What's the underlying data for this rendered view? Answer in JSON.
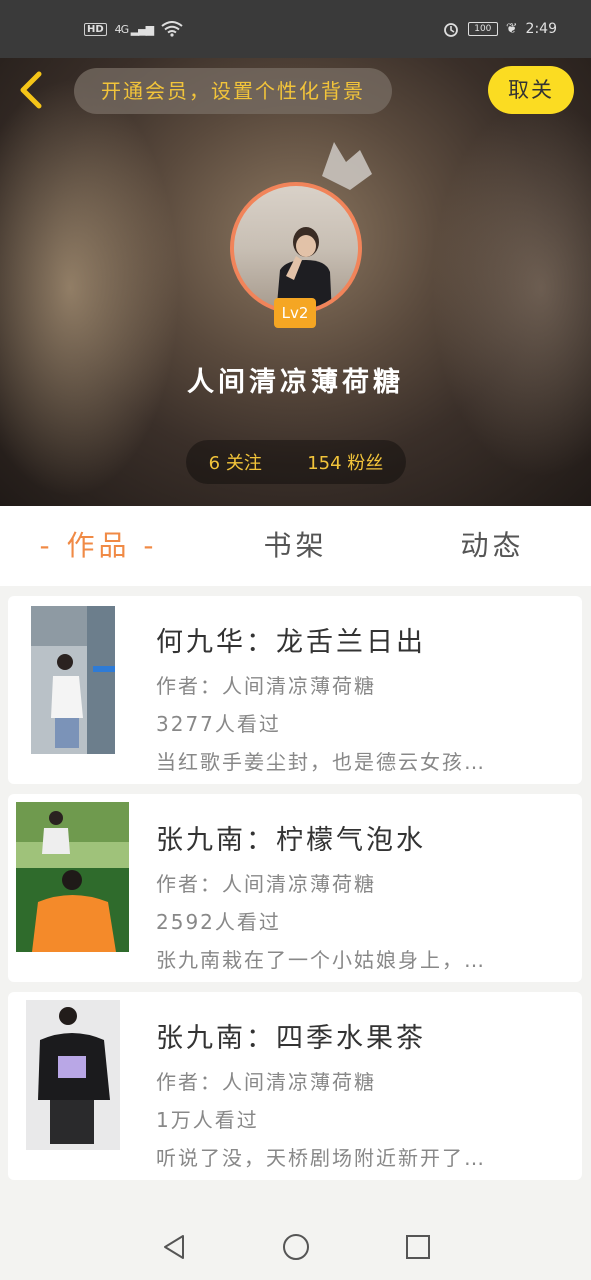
{
  "status_bar": {
    "network": "HD",
    "signal": "4G",
    "battery": "100",
    "time": "2:49"
  },
  "header": {
    "back_icon": "chevron-left-icon",
    "banner": "开通会员，设置个性化背景",
    "unfollow_label": "取关"
  },
  "profile": {
    "level": "Lv2",
    "username": "人间清凉薄荷糖",
    "following": "6 关注",
    "followers": "154 粉丝"
  },
  "tabs": [
    {
      "label": "- 作品 -",
      "active": true
    },
    {
      "label": "书架",
      "active": false
    },
    {
      "label": "动态",
      "active": false
    }
  ],
  "works": [
    {
      "title": "何九华：龙舌兰日出",
      "author": "作者：人间清凉薄荷糖",
      "views": "3277人看过",
      "desc": "当红歌手姜尘封，也是德云女孩…"
    },
    {
      "title": "张九南：柠檬气泡水",
      "author": "作者：人间清凉薄荷糖",
      "views": "2592人看过",
      "desc": "张九南栽在了一个小姑娘身上，…"
    },
    {
      "title": "张九南：四季水果茶",
      "author": "作者：人间清凉薄荷糖",
      "views": "1万人看过",
      "desc": "听说了没，天桥剧场附近新开了…"
    }
  ],
  "colors": {
    "accent": "#f08a45",
    "yellow": "#fbdc22",
    "banner_text": "#f2c43a"
  }
}
